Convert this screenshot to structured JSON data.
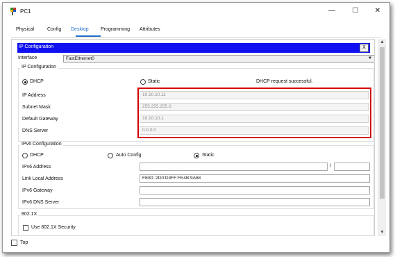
{
  "window": {
    "title": "PC1",
    "controls": {
      "minimize": "—",
      "maximize": "☐",
      "close": "✕"
    }
  },
  "tabs": [
    "Physical",
    "Config",
    "Desktop",
    "Programming",
    "Attributes"
  ],
  "active_tab": "Desktop",
  "ip_config": {
    "header": "IP Configuration",
    "close_label": "X",
    "interface_label": "Interface",
    "interface_value": "FastEthernet0",
    "ipv4_group_title": "IP Configuration",
    "dhcp_label": "DHCP",
    "static_label": "Static",
    "mode": "DHCP",
    "status": "DHCP request successful.",
    "ip_address_label": "IP Address",
    "ip_address": "10.10.10.11",
    "subnet_label": "Subnet Mask",
    "subnet": "255.255.255.0",
    "gateway_label": "Default Gateway",
    "gateway": "10.10.10.1",
    "dns_label": "DNS Server",
    "dns": "0.0.0.0"
  },
  "ipv6": {
    "group_title": "IPv6 Configuration",
    "dhcp_label": "DHCP",
    "auto_label": "Auto Config",
    "static_label": "Static",
    "mode": "Static",
    "address_label": "IPv6 Address",
    "address": "",
    "prefix": "",
    "prefix_sep": "/",
    "link_local_label": "Link Local Address",
    "link_local": "FE80::2D0:D3FF:FE4B:9A68",
    "gateway_label": "IPv6 Gateway",
    "gateway": "",
    "dns_label": "IPv6 DNS Server",
    "dns": ""
  },
  "dot1x": {
    "group_title": "802.1X",
    "use_label": "Use 802.1X Security",
    "checked": false
  },
  "bottom": {
    "top_label": "Top",
    "top_checked": false
  },
  "colors": {
    "accent": "#1e6fc8",
    "header_bar": "#1010f0",
    "highlight": "#d40000"
  }
}
